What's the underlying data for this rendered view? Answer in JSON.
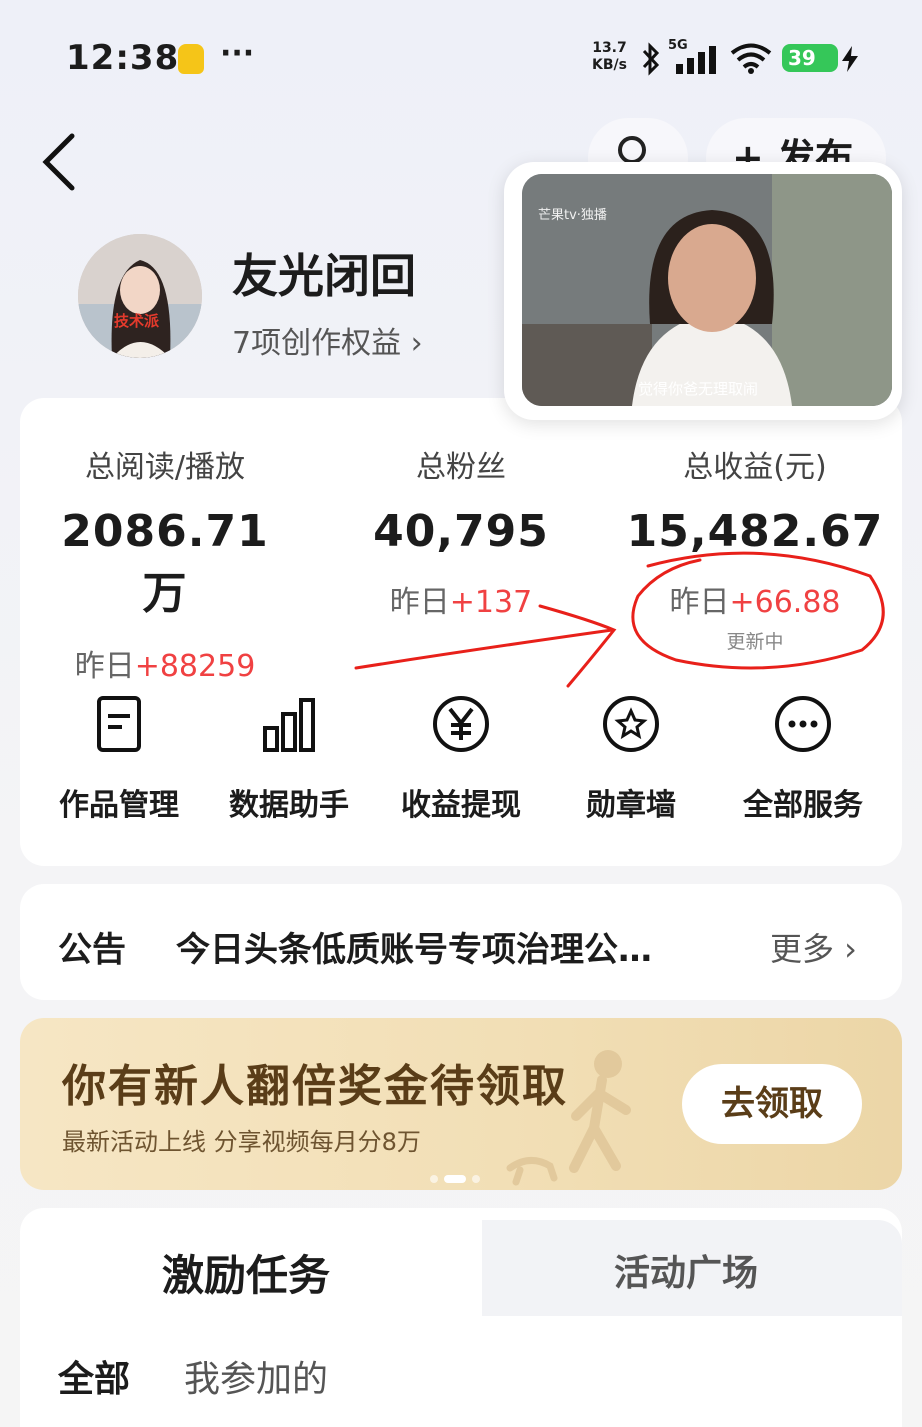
{
  "status_bar": {
    "time": "12:38",
    "more": "···",
    "net_speed_value": "13.7",
    "net_speed_unit": "KB/s",
    "network": "5G",
    "battery": "39"
  },
  "header": {
    "publish_label": "+ 发布"
  },
  "video": {
    "logo": "芒果tv·独播",
    "caption": "觉得你爸无理取闹"
  },
  "profile": {
    "avatar_tag": "技术派",
    "name": "友光闭回",
    "rights_label": "7项创作权益 ›"
  },
  "stats": [
    {
      "label": "总阅读/播放",
      "value": "2086.71万",
      "delta_prefix": "昨日",
      "delta": "+88259",
      "note": ""
    },
    {
      "label": "总粉丝",
      "value": "40,795",
      "delta_prefix": "昨日",
      "delta": "+137",
      "note": ""
    },
    {
      "label": "总收益(元)",
      "value": "15,482.67",
      "delta_prefix": "昨日",
      "delta": "+66.88",
      "note": "更新中"
    }
  ],
  "services": [
    {
      "label": "作品管理",
      "icon": "document-icon"
    },
    {
      "label": "数据助手",
      "icon": "bar-chart-icon"
    },
    {
      "label": "收益提现",
      "icon": "yuan-icon"
    },
    {
      "label": "勋章墙",
      "icon": "medal-icon"
    },
    {
      "label": "全部服务",
      "icon": "more-icon"
    }
  ],
  "notice": {
    "title": "公告",
    "text": "今日头条低质账号专项治理公…",
    "more": "更多 ›"
  },
  "banner": {
    "title": "你有新人翻倍奖金待领取",
    "subtitle": "最新活动上线 分享视频每月分8万",
    "button": "去领取"
  },
  "tabs": {
    "main": "激励任务",
    "second": "活动广场",
    "filter_all": "全部",
    "filter_mine": "我参加的"
  },
  "colors": {
    "accent_red": "#f04142",
    "annotation_red": "#e8201a",
    "banner_gold": "#f2dfb6"
  }
}
